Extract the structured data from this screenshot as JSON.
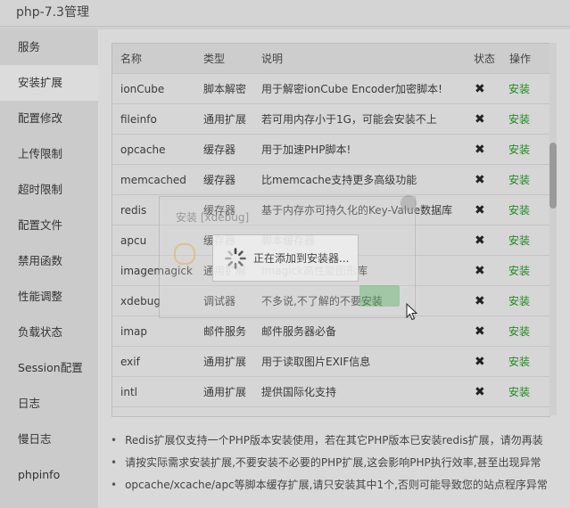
{
  "window": {
    "title": "php-7.3管理"
  },
  "sidebar": {
    "items": [
      {
        "label": "服务"
      },
      {
        "label": "安装扩展"
      },
      {
        "label": "配置修改"
      },
      {
        "label": "上传限制"
      },
      {
        "label": "超时限制"
      },
      {
        "label": "配置文件"
      },
      {
        "label": "禁用函数"
      },
      {
        "label": "性能调整"
      },
      {
        "label": "负载状态"
      },
      {
        "label": "Session配置"
      },
      {
        "label": "日志"
      },
      {
        "label": "慢日志"
      },
      {
        "label": "phpinfo"
      }
    ],
    "active_index": 1
  },
  "table": {
    "headers": {
      "name": "名称",
      "type": "类型",
      "desc": "说明",
      "status": "状态",
      "action": "操作"
    },
    "rows": [
      {
        "name": "ionCube",
        "type": "脚本解密",
        "desc": "用于解密ionCube Encoder加密脚本!",
        "status": "✖",
        "action": "安装"
      },
      {
        "name": "fileinfo",
        "type": "通用扩展",
        "desc": "若可用内存小于1G，可能会安装不上",
        "status": "✖",
        "action": "安装"
      },
      {
        "name": "opcache",
        "type": "缓存器",
        "desc": "用于加速PHP脚本!",
        "status": "✖",
        "action": "安装"
      },
      {
        "name": "memcached",
        "type": "缓存器",
        "desc": "比memcache支持更多高级功能",
        "status": "✖",
        "action": "安装"
      },
      {
        "name": "redis",
        "type": "缓存器",
        "desc": "基于内存亦可持久化的Key-Value数据库",
        "status": "✖",
        "action": "安装"
      },
      {
        "name": "apcu",
        "type": "缓存器",
        "desc": "脚本缓存器",
        "status": "✖",
        "action": "安装"
      },
      {
        "name": "imagemagick",
        "type": "通用扩展",
        "desc": "Imagick高性能图形库",
        "status": "✖",
        "action": "安装"
      },
      {
        "name": "xdebug",
        "type": "调试器",
        "desc": "不多说,不了解的不要安装",
        "status": "✖",
        "action": "安装"
      },
      {
        "name": "imap",
        "type": "邮件服务",
        "desc": "邮件服务器必备",
        "status": "✖",
        "action": "安装"
      },
      {
        "name": "exif",
        "type": "通用扩展",
        "desc": "用于读取图片EXIF信息",
        "status": "✖",
        "action": "安装"
      },
      {
        "name": "intl",
        "type": "通用扩展",
        "desc": "提供国际化支持",
        "status": "✖",
        "action": "安装"
      }
    ]
  },
  "notes": [
    "Redis扩展仅支持一个PHP版本安装使用，若在其它PHP版本已安装redis扩展，请勿再装",
    "请按实际需求安装扩展,不要安装不必要的PHP扩展,这会影响PHP执行效率,甚至出现异常",
    "opcache/xcache/apc等脚本缓存扩展,请只安装其中1个,否则可能导致您的站点程序异常"
  ],
  "ghost_dialog": {
    "title": "安装 [xdebug]"
  },
  "loading": {
    "text": "正在添加到安装器..."
  },
  "colors": {
    "install_link": "#1f8a1f",
    "page_bg": "#cfcfcf"
  }
}
